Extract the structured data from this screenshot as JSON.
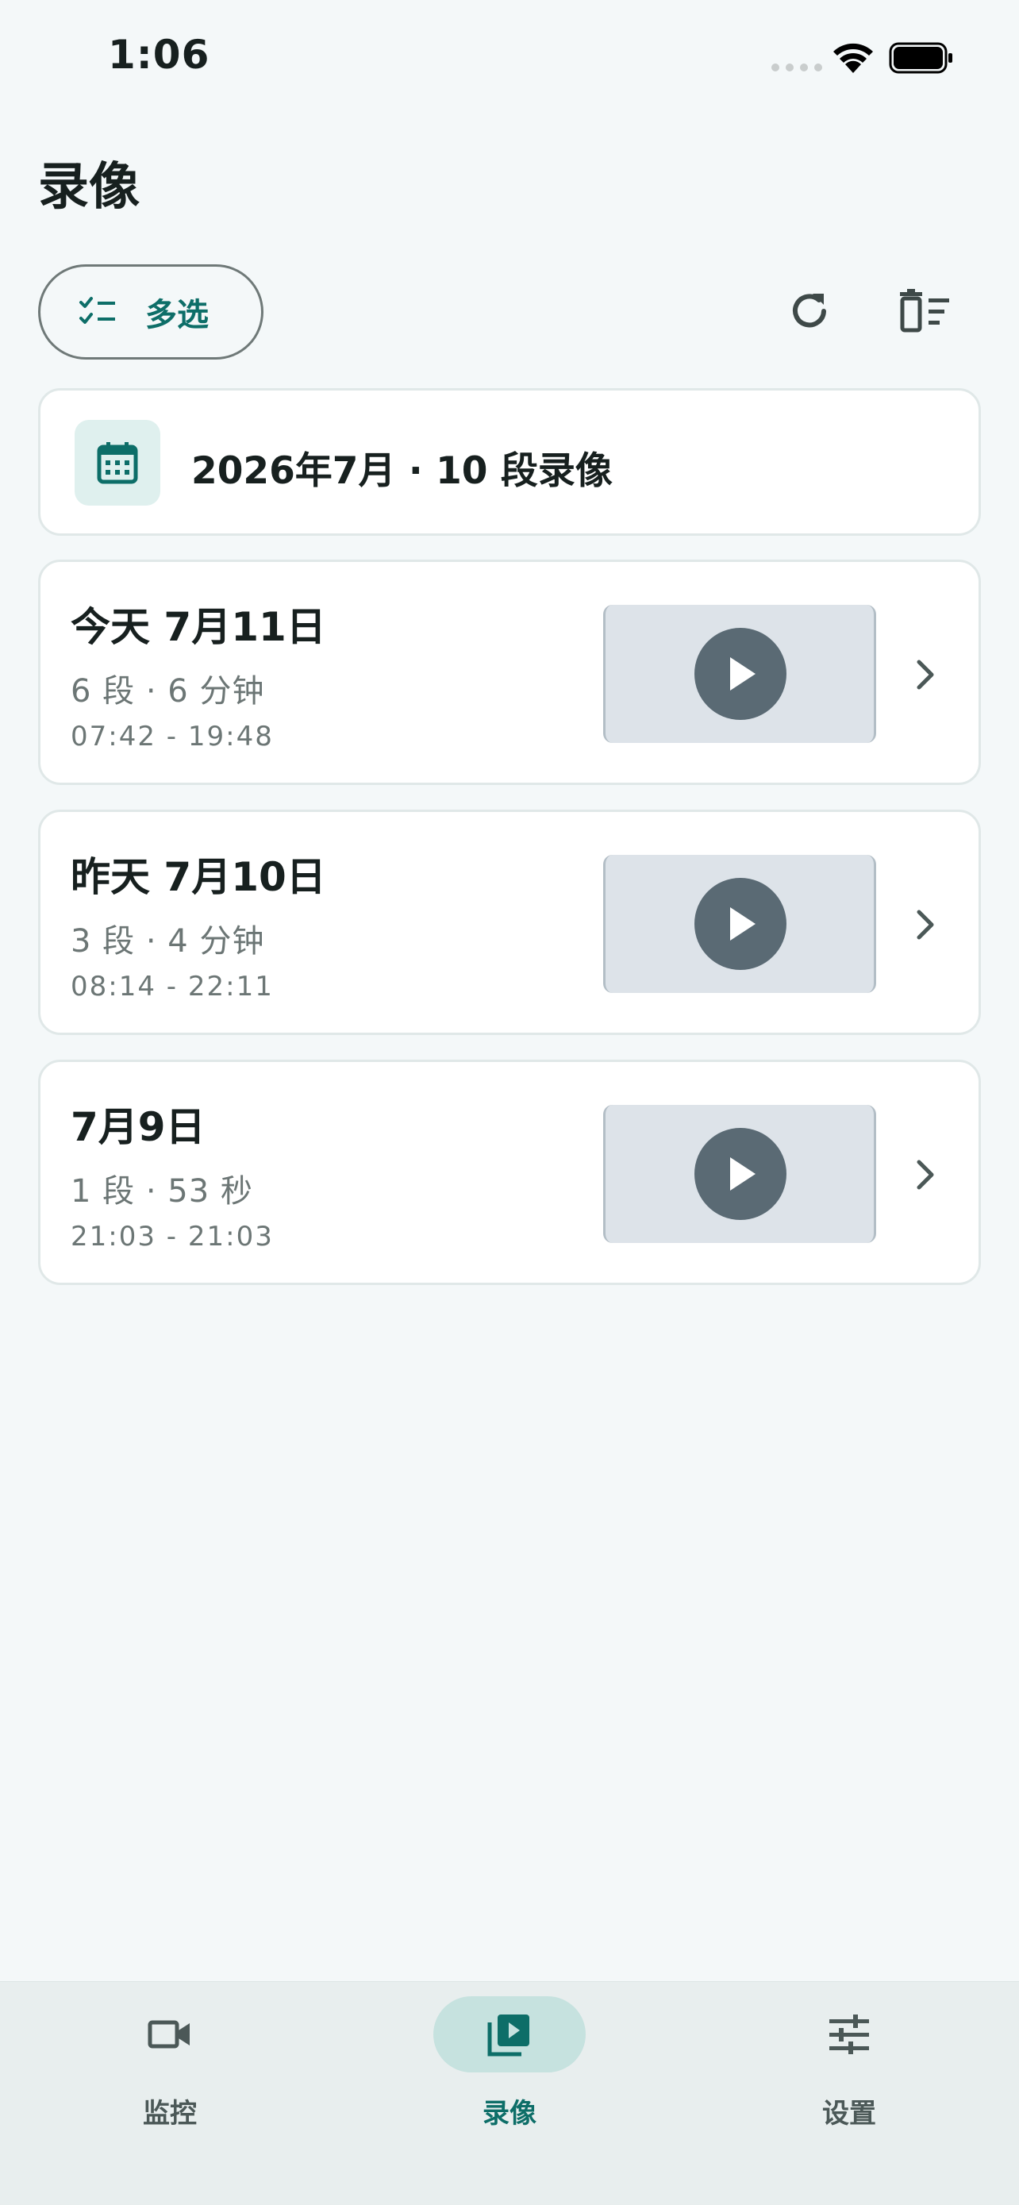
{
  "status": {
    "time": "1:06"
  },
  "page": {
    "title": "录像"
  },
  "toolbar": {
    "multi_select_label": "多选",
    "refresh_icon": "refresh-icon",
    "clear_icon": "delete-sweep-icon"
  },
  "month": {
    "label": "2026年7月 · 10 段录像",
    "icon": "calendar-icon"
  },
  "days": [
    {
      "title": "今天 7月11日",
      "summary": "6 段 · 6 分钟",
      "range": "07:42 - 19:48"
    },
    {
      "title": "昨天 7月10日",
      "summary": "3 段 · 4 分钟",
      "range": "08:14 - 22:11"
    },
    {
      "title": "7月9日",
      "summary": "1 段 · 53 秒",
      "range": "21:03 - 21:03"
    }
  ],
  "nav": [
    {
      "label": "监控",
      "icon": "videocam-icon",
      "active": false
    },
    {
      "label": "录像",
      "icon": "video-library-icon",
      "active": true
    },
    {
      "label": "设置",
      "icon": "tune-icon",
      "active": false
    }
  ],
  "colors": {
    "accent": "#0d6e68",
    "background": "#f4f8f9",
    "card": "#ffffff",
    "thumb": "#dde3e9",
    "play": "#5a6a74"
  }
}
